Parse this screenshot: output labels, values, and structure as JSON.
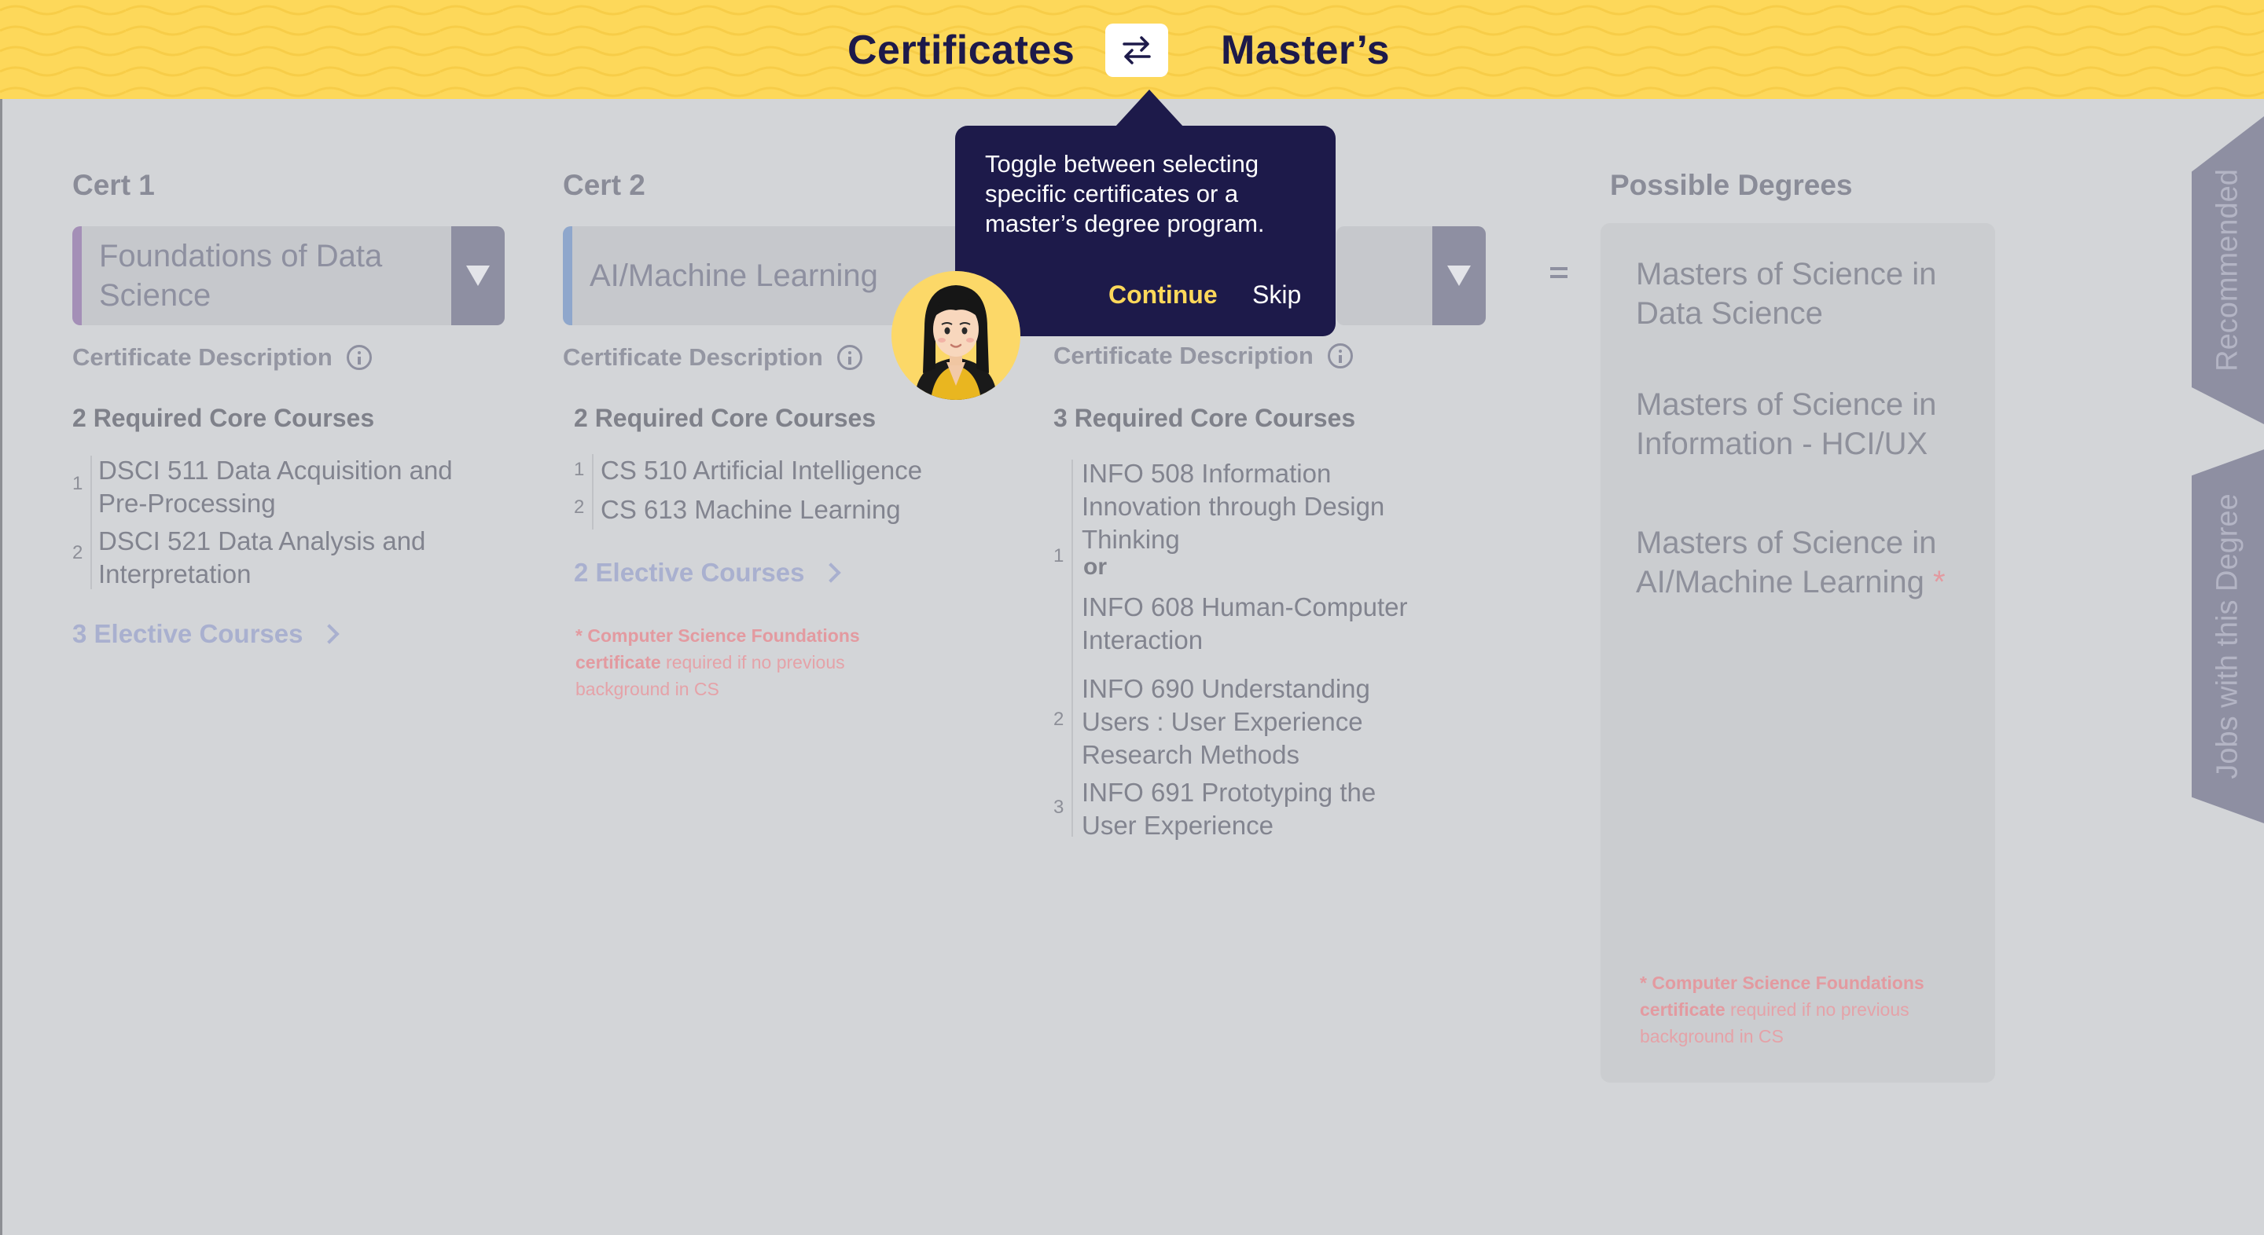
{
  "header": {
    "left_mode": "Certificates",
    "right_mode": "Master’s",
    "toggle_icon": "swap-arrows-icon"
  },
  "colors": {
    "header_bg": "#fdd85a",
    "navy": "#1d1a4a",
    "cert1_accent": "#a48fb7",
    "cert2_accent": "#8fa7cc",
    "note_red": "#e39aa0"
  },
  "cert1": {
    "title": "Cert 1",
    "selected_line1": "Foundations of Data",
    "selected_line2": "Science",
    "description_label": "Certificate Description",
    "core_heading": "2 Required Core Courses",
    "courses": [
      {
        "num": "1",
        "line1": "DSCI 511 Data Acquisition and",
        "line2": "Pre-Processing"
      },
      {
        "num": "2",
        "line1": "DSCI 521 Data Analysis and",
        "line2": "Interpretation"
      }
    ],
    "elective": "3 Elective Courses"
  },
  "cert2": {
    "title": "Cert 2",
    "selected": "AI/Machine Learning",
    "description_label": "Certificate Description",
    "core_heading": "2 Required Core Courses",
    "courses": [
      {
        "num": "1",
        "text": "CS 510 Artificial Intelligence"
      },
      {
        "num": "2",
        "text": "CS 613 Machine Learning"
      }
    ],
    "elective": "2 Elective Courses",
    "note_bold_1": "* Computer Science Foundations",
    "note_bold_2": "certificate",
    "note_rest_2": " required if no previous",
    "note_3": "background in CS"
  },
  "cert3": {
    "description_label": "Certificate Description",
    "core_heading": "3 Required Core Courses",
    "course1_num": "1",
    "course1a_lines": [
      "INFO 508 Information",
      "Innovation through Design",
      "Thinking"
    ],
    "or": "or",
    "course1b_lines": [
      "INFO 608 Human-Computer",
      "Interaction"
    ],
    "course2_num": "2",
    "course2_lines": [
      "INFO 690 Understanding",
      "Users : User Experience",
      "Research Methods"
    ],
    "course3_num": "3",
    "course3_lines": [
      "INFO 691 Prototyping the",
      "User Experience"
    ]
  },
  "degrees": {
    "title": "Possible Degrees",
    "items": [
      {
        "line1": "Masters of Science in",
        "line2": "Data Science",
        "star": ""
      },
      {
        "line1": "Masters of Science in",
        "line2": "Information - HCI/UX",
        "star": ""
      },
      {
        "line1": "Masters of Science in",
        "line2": "AI/Machine Learning",
        "star": "*"
      }
    ],
    "note_bold_1": "* Computer Science Foundations",
    "note_bold_2": "certificate",
    "note_rest_2": " required if no previous",
    "note_3": "background in CS"
  },
  "side_tabs": {
    "recommended": "Recommended",
    "jobs": "Jobs with this Degree"
  },
  "tooltip": {
    "line1": "Toggle between selecting",
    "line2": "specific certificates or a",
    "line3": "master’s degree program.",
    "continue": "Continue",
    "skip": "Skip"
  }
}
